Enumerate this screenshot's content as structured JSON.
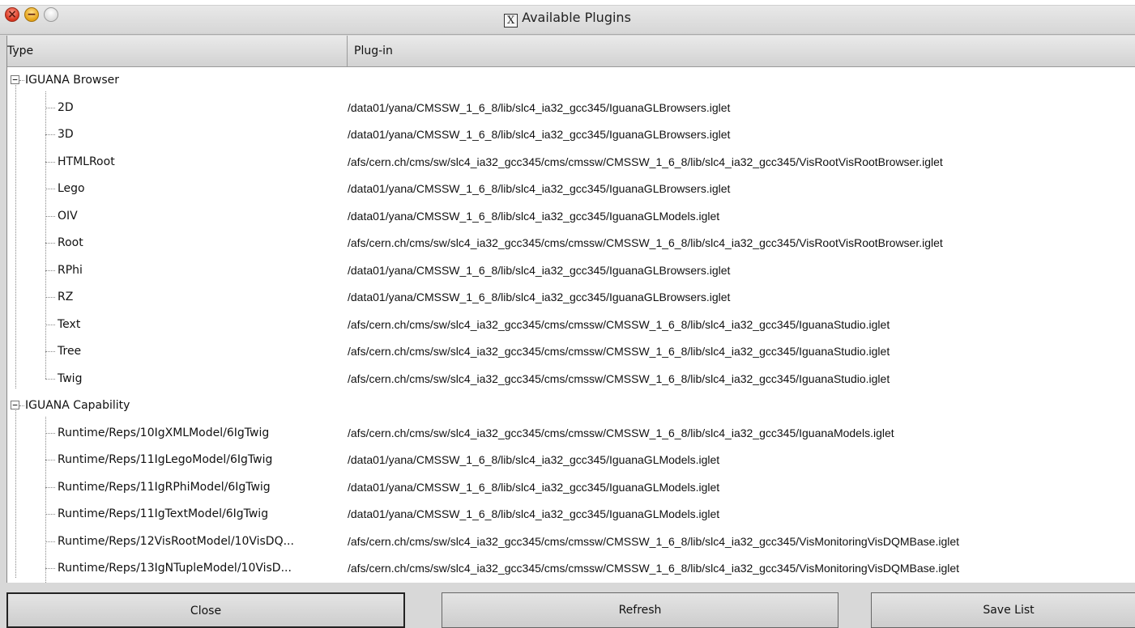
{
  "window": {
    "title": "Available Plugins",
    "title_icon": "X"
  },
  "columns": {
    "type": "Type",
    "plugin": "Plug-in"
  },
  "groups": [
    {
      "label": "IGUANA Browser",
      "expanded": true,
      "children": [
        {
          "type": "2D",
          "plugin": "/data01/yana/CMSSW_1_6_8/lib/slc4_ia32_gcc345/IguanaGLBrowsers.iglet"
        },
        {
          "type": "3D",
          "plugin": "/data01/yana/CMSSW_1_6_8/lib/slc4_ia32_gcc345/IguanaGLBrowsers.iglet"
        },
        {
          "type": "HTMLRoot",
          "plugin": "/afs/cern.ch/cms/sw/slc4_ia32_gcc345/cms/cmssw/CMSSW_1_6_8/lib/slc4_ia32_gcc345/VisRootVisRootBrowser.iglet"
        },
        {
          "type": "Lego",
          "plugin": "/data01/yana/CMSSW_1_6_8/lib/slc4_ia32_gcc345/IguanaGLBrowsers.iglet"
        },
        {
          "type": "OIV",
          "plugin": "/data01/yana/CMSSW_1_6_8/lib/slc4_ia32_gcc345/IguanaGLModels.iglet"
        },
        {
          "type": "Root",
          "plugin": "/afs/cern.ch/cms/sw/slc4_ia32_gcc345/cms/cmssw/CMSSW_1_6_8/lib/slc4_ia32_gcc345/VisRootVisRootBrowser.iglet"
        },
        {
          "type": "RPhi",
          "plugin": "/data01/yana/CMSSW_1_6_8/lib/slc4_ia32_gcc345/IguanaGLBrowsers.iglet"
        },
        {
          "type": "RZ",
          "plugin": "/data01/yana/CMSSW_1_6_8/lib/slc4_ia32_gcc345/IguanaGLBrowsers.iglet"
        },
        {
          "type": "Text",
          "plugin": "/afs/cern.ch/cms/sw/slc4_ia32_gcc345/cms/cmssw/CMSSW_1_6_8/lib/slc4_ia32_gcc345/IguanaStudio.iglet"
        },
        {
          "type": "Tree",
          "plugin": "/afs/cern.ch/cms/sw/slc4_ia32_gcc345/cms/cmssw/CMSSW_1_6_8/lib/slc4_ia32_gcc345/IguanaStudio.iglet"
        },
        {
          "type": "Twig",
          "plugin": "/afs/cern.ch/cms/sw/slc4_ia32_gcc345/cms/cmssw/CMSSW_1_6_8/lib/slc4_ia32_gcc345/IguanaStudio.iglet"
        }
      ]
    },
    {
      "label": "IGUANA Capability",
      "expanded": true,
      "children": [
        {
          "type": "Runtime/Reps/10IgXMLModel/6IgTwig",
          "plugin": "/afs/cern.ch/cms/sw/slc4_ia32_gcc345/cms/cmssw/CMSSW_1_6_8/lib/slc4_ia32_gcc345/IguanaModels.iglet"
        },
        {
          "type": "Runtime/Reps/11IgLegoModel/6IgTwig",
          "plugin": "/data01/yana/CMSSW_1_6_8/lib/slc4_ia32_gcc345/IguanaGLModels.iglet"
        },
        {
          "type": "Runtime/Reps/11IgRPhiModel/6IgTwig",
          "plugin": "/data01/yana/CMSSW_1_6_8/lib/slc4_ia32_gcc345/IguanaGLModels.iglet"
        },
        {
          "type": "Runtime/Reps/11IgTextModel/6IgTwig",
          "plugin": "/data01/yana/CMSSW_1_6_8/lib/slc4_ia32_gcc345/IguanaGLModels.iglet"
        },
        {
          "type": "Runtime/Reps/12VisRootModel/10VisDQ...",
          "plugin": "/afs/cern.ch/cms/sw/slc4_ia32_gcc345/cms/cmssw/CMSSW_1_6_8/lib/slc4_ia32_gcc345/VisMonitoringVisDQMBase.iglet"
        },
        {
          "type": "Runtime/Reps/13IgNTupleModel/10VisD...",
          "plugin": "/afs/cern.ch/cms/sw/slc4_ia32_gcc345/cms/cmssw/CMSSW_1_6_8/lib/slc4_ia32_gcc345/VisMonitoringVisDQMBase.iglet"
        }
      ]
    }
  ],
  "buttons": {
    "close": "Close",
    "refresh": "Refresh",
    "save": "Save List"
  }
}
